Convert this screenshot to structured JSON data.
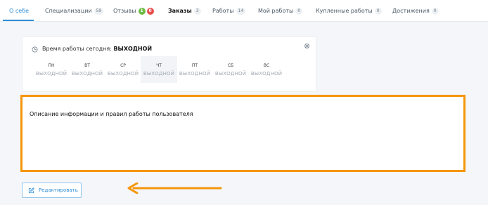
{
  "tabs": [
    {
      "label": "О себе"
    },
    {
      "label": "Специализации",
      "count": "59"
    },
    {
      "label": "Отзывы",
      "badge_positive": "1",
      "badge_negative": "0"
    },
    {
      "label": "Заказы",
      "count": "3"
    },
    {
      "label": "Работы",
      "count": "14"
    },
    {
      "label": "Мой работы",
      "count": "0"
    },
    {
      "label": "Купленные работы",
      "count": "0"
    },
    {
      "label": "Достижения",
      "count": "0"
    }
  ],
  "active_tab": "О себе",
  "work_time": {
    "label": "Время работы сегодня:",
    "value": "ВЫХОДНОЙ",
    "days": [
      {
        "name": "ПН",
        "state": "ВЫХОДНОЙ"
      },
      {
        "name": "ВТ",
        "state": "ВЫХОДНОЙ"
      },
      {
        "name": "СР",
        "state": "ВЫХОДНОЙ"
      },
      {
        "name": "ЧТ",
        "state": "ВЫХОДНОЙ"
      },
      {
        "name": "ПТ",
        "state": "ВЫХОДНОЙ"
      },
      {
        "name": "СБ",
        "state": "ВЫХОДНОЙ"
      },
      {
        "name": "ВС",
        "state": "ВЫХОДНОЙ"
      }
    ],
    "current_day": "ЧТ"
  },
  "description": {
    "text": "Описание информации и правил работы пользователя"
  },
  "edit_button": {
    "label": "Редактировать"
  },
  "colors": {
    "accent": "#2f8fd8",
    "highlight": "#f5960a",
    "badge_positive": "#6dbb43",
    "badge_negative": "#e84e4e"
  },
  "icons": {
    "clock": "clock-icon",
    "settings": "gear-icon",
    "edit": "edit-icon",
    "arrow": "arrow-left-icon"
  }
}
